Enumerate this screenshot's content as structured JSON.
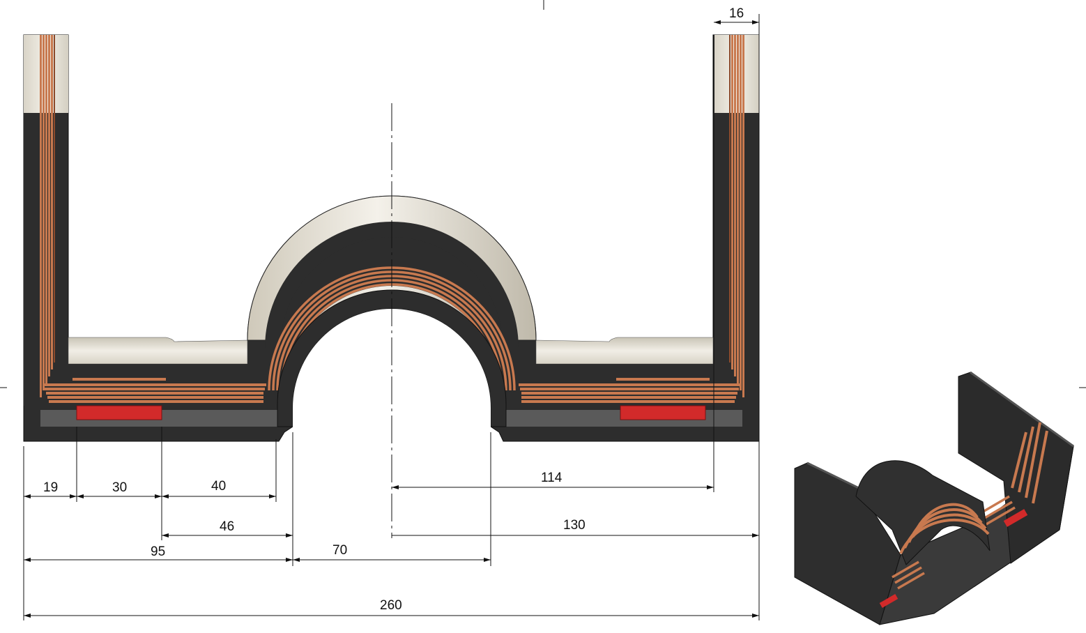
{
  "drawing": {
    "dimensions": {
      "d16": "16",
      "d19": "19",
      "d30": "30",
      "d40": "40",
      "d46": "46",
      "d95": "95",
      "d70": "70",
      "d114": "114",
      "d130": "130",
      "d260": "260"
    },
    "colors": {
      "core_dark": "#2e2e2e",
      "core_light": "#e8e4da",
      "copper": "#c8794f",
      "copper_dark": "#8a4a2c",
      "heater_red": "#d22a2a",
      "bottom_gray": "#5a5a5a"
    }
  }
}
